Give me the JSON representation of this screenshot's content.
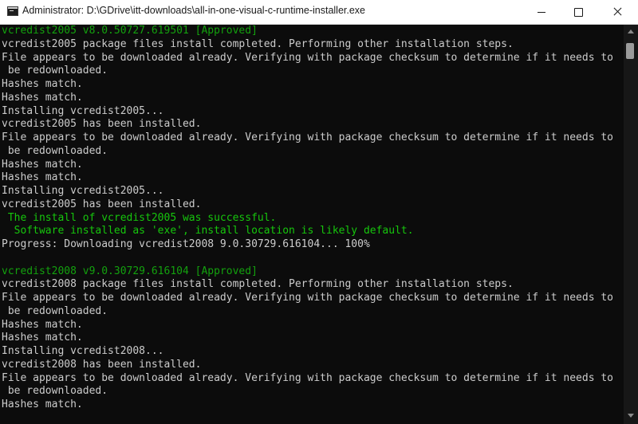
{
  "window": {
    "title": "Administrator: D:\\GDrive\\itt-downloads\\all-in-one-visual-c-runtime-installer.exe",
    "icon": "console-window-icon",
    "caption_buttons": [
      "minimize-icon",
      "maximize-icon",
      "close-icon"
    ]
  },
  "colors": {
    "background": "#0c0c0c",
    "text": "#cccccc",
    "success": "#13a10e",
    "success_bright": "#16c60c",
    "titlebar": "#ffffff"
  },
  "console": {
    "lines": [
      {
        "text": "vcredist2005 v8.0.50727.619501 [Approved]",
        "style": "green"
      },
      {
        "text": "vcredist2005 package files install completed. Performing other installation steps.",
        "style": "normal"
      },
      {
        "text": "File appears to be downloaded already. Verifying with package checksum to determine if it needs to",
        "style": "normal"
      },
      {
        "text": " be redownloaded.",
        "style": "normal"
      },
      {
        "text": "Hashes match.",
        "style": "normal"
      },
      {
        "text": "Hashes match.",
        "style": "normal"
      },
      {
        "text": "Installing vcredist2005...",
        "style": "normal"
      },
      {
        "text": "vcredist2005 has been installed.",
        "style": "normal"
      },
      {
        "text": "File appears to be downloaded already. Verifying with package checksum to determine if it needs to",
        "style": "normal"
      },
      {
        "text": " be redownloaded.",
        "style": "normal"
      },
      {
        "text": "Hashes match.",
        "style": "normal"
      },
      {
        "text": "Hashes match.",
        "style": "normal"
      },
      {
        "text": "Installing vcredist2005...",
        "style": "normal"
      },
      {
        "text": "vcredist2005 has been installed.",
        "style": "normal"
      },
      {
        "text": " The install of vcredist2005 was successful.",
        "style": "bright"
      },
      {
        "text": "  Software installed as 'exe', install location is likely default.",
        "style": "bright"
      },
      {
        "text": "Progress: Downloading vcredist2008 9.0.30729.616104... 100%",
        "style": "normal"
      },
      {
        "text": "",
        "style": "normal"
      },
      {
        "text": "vcredist2008 v9.0.30729.616104 [Approved]",
        "style": "green"
      },
      {
        "text": "vcredist2008 package files install completed. Performing other installation steps.",
        "style": "normal"
      },
      {
        "text": "File appears to be downloaded already. Verifying with package checksum to determine if it needs to",
        "style": "normal"
      },
      {
        "text": " be redownloaded.",
        "style": "normal"
      },
      {
        "text": "Hashes match.",
        "style": "normal"
      },
      {
        "text": "Hashes match.",
        "style": "normal"
      },
      {
        "text": "Installing vcredist2008...",
        "style": "normal"
      },
      {
        "text": "vcredist2008 has been installed.",
        "style": "normal"
      },
      {
        "text": "File appears to be downloaded already. Verifying with package checksum to determine if it needs to",
        "style": "normal"
      },
      {
        "text": " be redownloaded.",
        "style": "normal"
      },
      {
        "text": "Hashes match.",
        "style": "normal"
      }
    ]
  }
}
